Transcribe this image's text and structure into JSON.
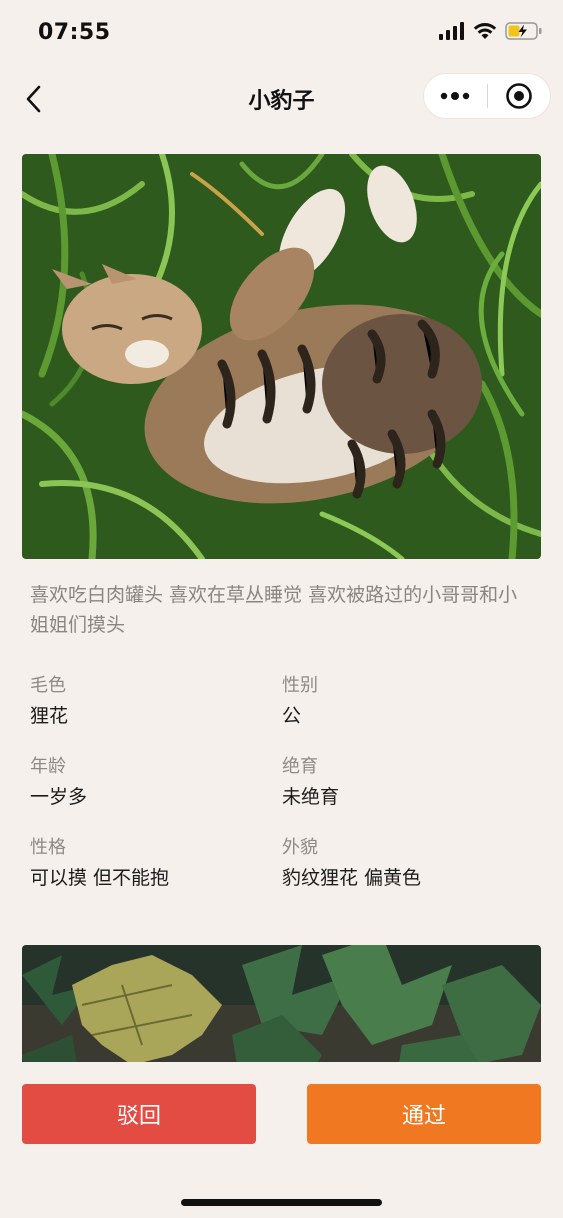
{
  "status_bar": {
    "time": "07:55",
    "icons": [
      "signal-icon",
      "wifi-icon",
      "battery-charging-icon"
    ]
  },
  "nav": {
    "title": "小豹子",
    "back_icon": "chevron-left-icon",
    "more_icon": "more-dots-icon",
    "close_icon": "target-close-icon"
  },
  "cat": {
    "description": "喜欢吃白肉罐头 喜欢在草丛睡觉 喜欢被路过的小哥哥和小姐姐们摸头",
    "photos": [
      {
        "subject": "tabby cat sleeping in grass"
      },
      {
        "subject": "green plant leaves"
      }
    ],
    "attributes": [
      {
        "label": "毛色",
        "value": "狸花"
      },
      {
        "label": "性别",
        "value": "公"
      },
      {
        "label": "年龄",
        "value": "一岁多"
      },
      {
        "label": "绝育",
        "value": "未绝育"
      },
      {
        "label": "性格",
        "value": "可以摸 但不能抱"
      },
      {
        "label": "外貌",
        "value": "豹纹狸花 偏黄色"
      }
    ]
  },
  "actions": {
    "reject_label": "驳回",
    "approve_label": "通过",
    "reject_color": "#e34c42",
    "approve_color": "#f07820"
  },
  "colors": {
    "background": "#f5f0ec",
    "secondary_text": "#8a8580"
  }
}
